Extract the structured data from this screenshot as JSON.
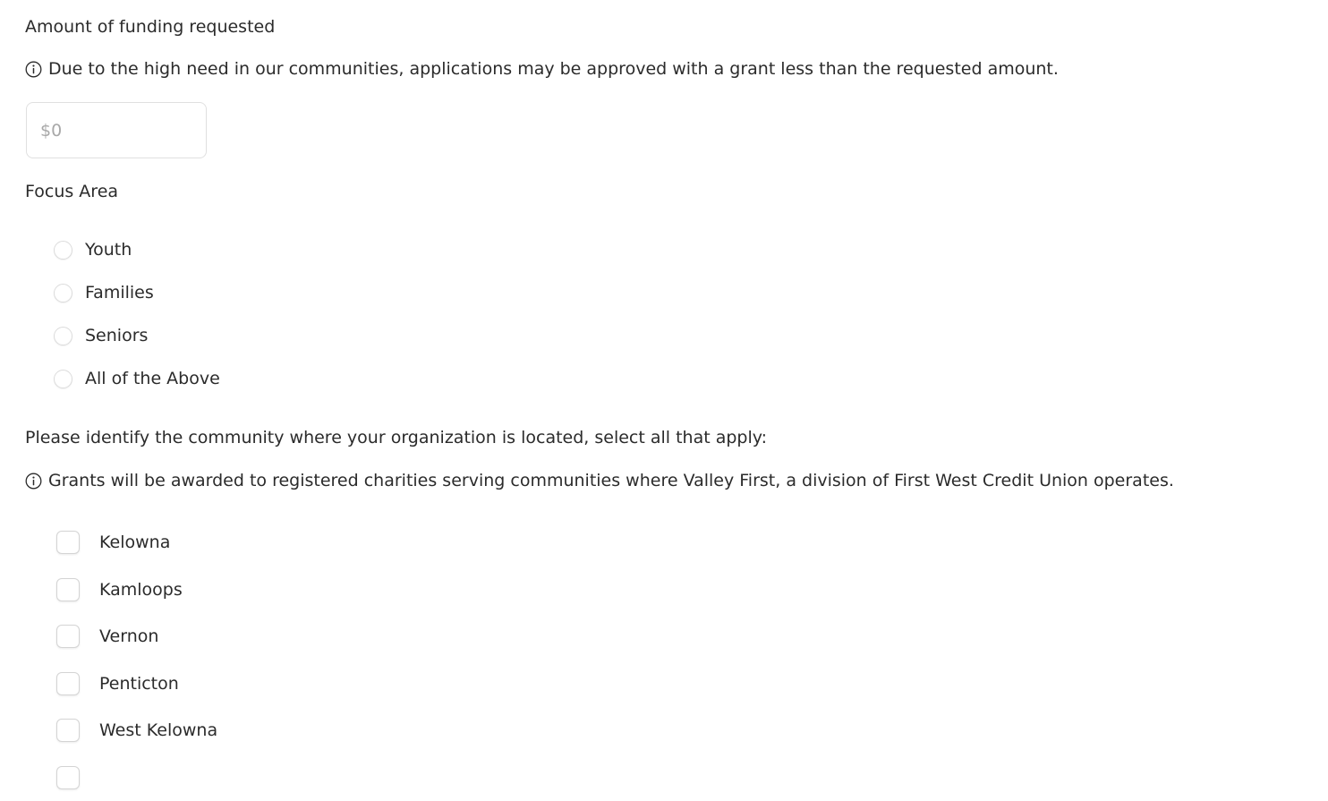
{
  "funding": {
    "heading": "Amount of funding requested",
    "helper_text": "Due to the high need in our communities, applications may be approved with a grant less than the requested amount.",
    "info_icon": "info-circle-icon",
    "amount_value": "",
    "amount_placeholder": "$0"
  },
  "focus_area": {
    "heading": "Focus Area",
    "options": [
      {
        "label": "Youth",
        "selected": false
      },
      {
        "label": "Families",
        "selected": false
      },
      {
        "label": "Seniors",
        "selected": false
      },
      {
        "label": "All of the Above",
        "selected": false
      }
    ]
  },
  "community": {
    "heading": "Please identify the community where your organization is located, select all that apply:",
    "helper_text": "Grants will be awarded to registered charities serving communities where Valley First, a division of First West Credit Union operates.",
    "info_icon": "info-circle-icon",
    "options": [
      {
        "label": "Kelowna",
        "checked": false
      },
      {
        "label": "Kamloops",
        "checked": false
      },
      {
        "label": "Vernon",
        "checked": false
      },
      {
        "label": "Penticton",
        "checked": false
      },
      {
        "label": "West Kelowna",
        "checked": false
      },
      {
        "label": "",
        "checked": false
      }
    ]
  },
  "colors": {
    "background": "#ffffff",
    "text": "#2b2b2b",
    "placeholder": "#a8a8a8",
    "field_border": "#e0e0e0",
    "control_border": "#d4d4d4"
  }
}
